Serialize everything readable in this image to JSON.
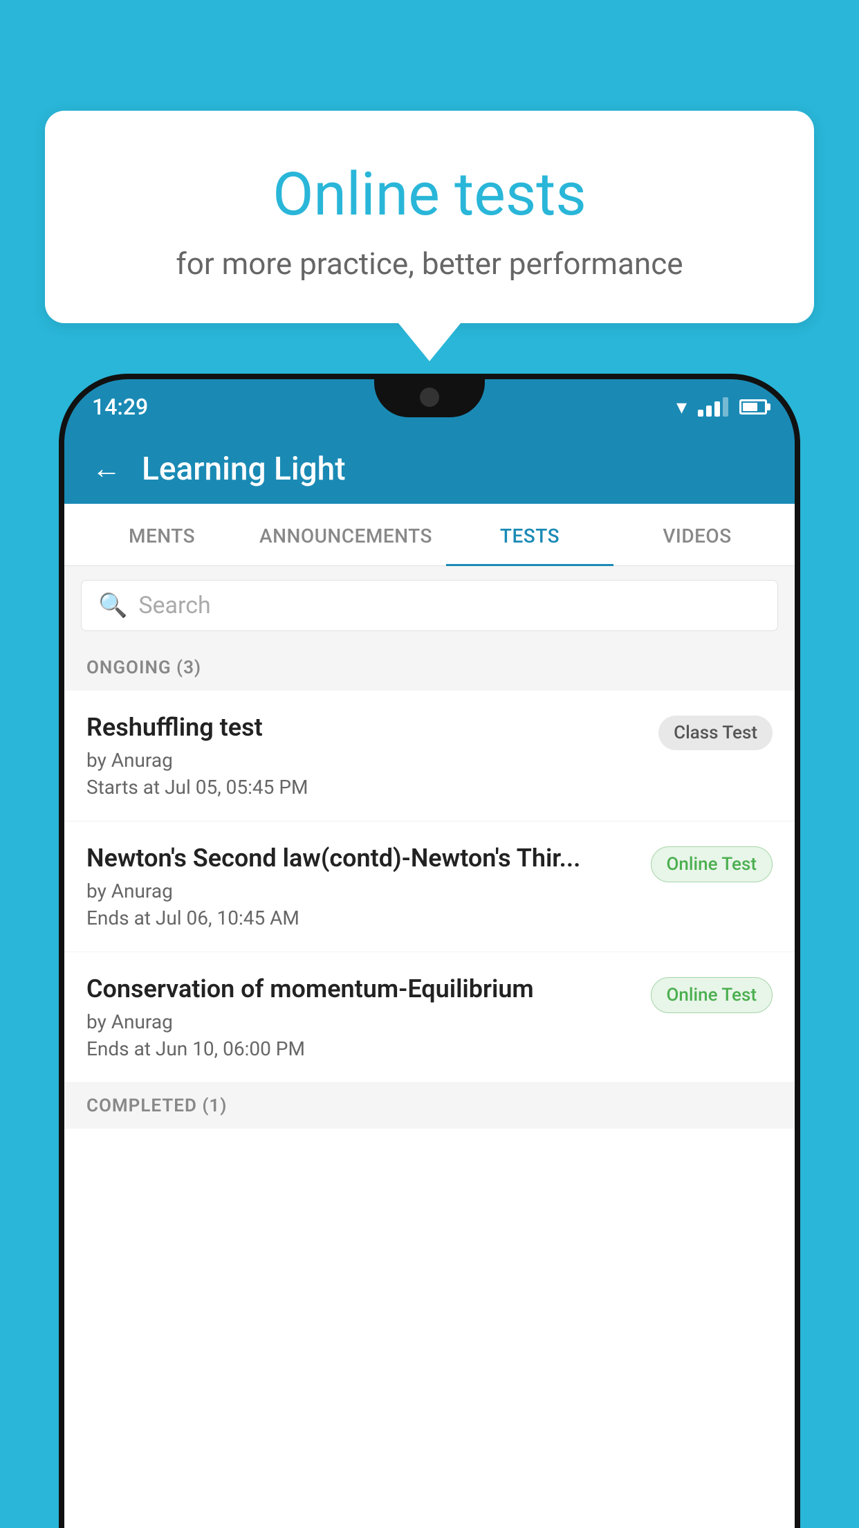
{
  "background": {
    "color": "#29b6d8"
  },
  "speechBubble": {
    "title": "Online tests",
    "subtitle": "for more practice, better performance"
  },
  "phone": {
    "statusBar": {
      "time": "14:29",
      "icons": [
        "wifi",
        "signal",
        "battery"
      ]
    },
    "header": {
      "backLabel": "←",
      "title": "Learning Light"
    },
    "tabs": [
      {
        "label": "MENTS",
        "active": false
      },
      {
        "label": "ANNOUNCEMENTS",
        "active": false
      },
      {
        "label": "TESTS",
        "active": true
      },
      {
        "label": "VIDEOS",
        "active": false
      }
    ],
    "search": {
      "placeholder": "Search"
    },
    "ongoingSection": {
      "label": "ONGOING (3)"
    },
    "tests": [
      {
        "name": "Reshuffling test",
        "by": "by Anurag",
        "time": "Starts at  Jul 05, 05:45 PM",
        "badge": "Class Test",
        "badgeType": "class"
      },
      {
        "name": "Newton's Second law(contd)-Newton's Thir...",
        "by": "by Anurag",
        "time": "Ends at  Jul 06, 10:45 AM",
        "badge": "Online Test",
        "badgeType": "online"
      },
      {
        "name": "Conservation of momentum-Equilibrium",
        "by": "by Anurag",
        "time": "Ends at  Jun 10, 06:00 PM",
        "badge": "Online Test",
        "badgeType": "online"
      }
    ],
    "completedSection": {
      "label": "COMPLETED (1)"
    }
  }
}
